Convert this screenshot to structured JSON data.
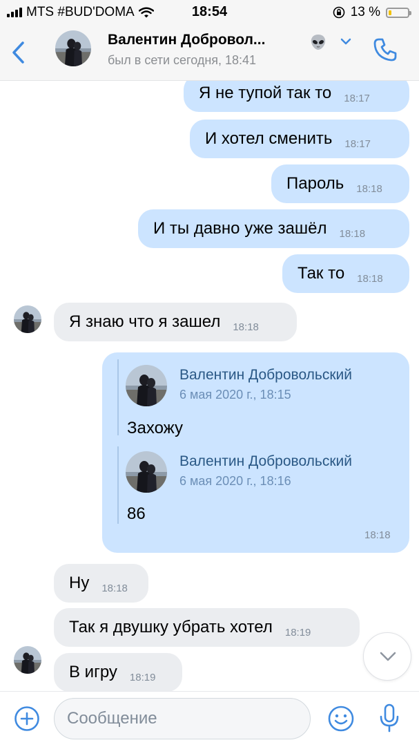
{
  "status_bar": {
    "carrier": "MTS #BUD'DOMA",
    "time": "18:54",
    "battery": "13 %",
    "battery_level": 0.13
  },
  "header": {
    "name": "Валентин Добровол...",
    "status": "был в сети сегодня, 18:41",
    "emoji": "👽"
  },
  "messages": [
    {
      "dir": "out",
      "text": "Я не тупой так то",
      "time": "18:17"
    },
    {
      "dir": "out",
      "text": "И хотел сменить",
      "time": "18:17"
    },
    {
      "dir": "out",
      "text": "Пароль",
      "time": "18:18"
    },
    {
      "dir": "out",
      "text": "И ты давно уже зашёл",
      "time": "18:18"
    },
    {
      "dir": "out",
      "text": "Так то",
      "time": "18:18"
    },
    {
      "dir": "in",
      "text": "Я знаю что я зашел",
      "time": "18:18"
    },
    {
      "dir": "in",
      "text": "Ну",
      "time": "18:18"
    },
    {
      "dir": "in",
      "text": "Так я двушку убрать хотел",
      "time": "18:19"
    },
    {
      "dir": "in",
      "text": "В игру",
      "time": "18:19"
    }
  ],
  "forward": {
    "time": "18:18",
    "items": [
      {
        "author": "Валентин Добровольский",
        "date": "6 мая 2020 г., 18:15",
        "text": "Захожу"
      },
      {
        "author": "Валентин Добровольский",
        "date": "6 мая 2020 г., 18:16",
        "text": "86"
      }
    ]
  },
  "composer": {
    "placeholder": "Сообщение"
  },
  "colors": {
    "accent": "#3f8ae0",
    "outgoing_bubble": "#cce4ff",
    "incoming_bubble": "#ebedf0"
  },
  "icons": [
    "back-icon",
    "chevron-down-icon",
    "phone-icon",
    "plus-icon",
    "smile-icon",
    "microphone-icon",
    "scroll-down-icon"
  ]
}
